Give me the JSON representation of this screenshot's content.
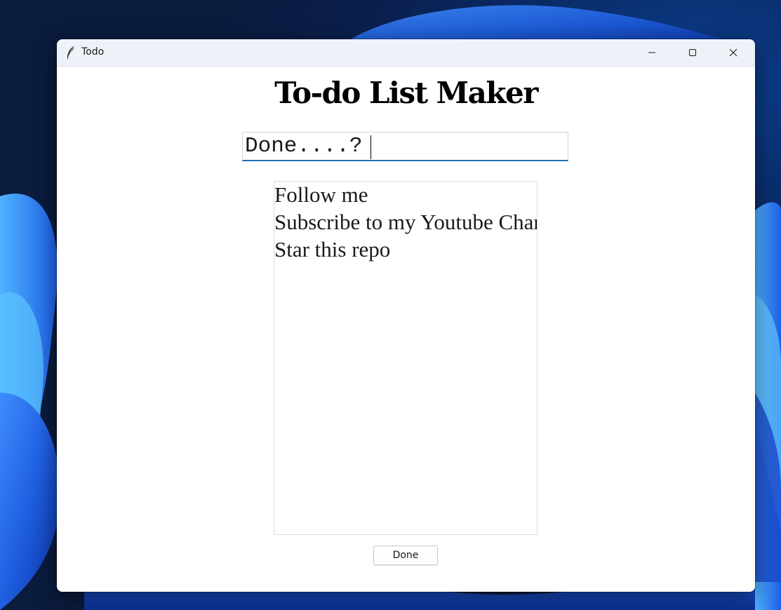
{
  "window": {
    "title": "Todo",
    "controls": {
      "minimize": "minimize-icon",
      "maximize": "maximize-icon",
      "close": "close-icon"
    }
  },
  "app": {
    "heading": "To-do List Maker",
    "entry_value": "Done....?",
    "entry_focus_color": "#1f6fb5",
    "tasks": [
      "Follow me",
      "Subscribe to my Youtube Channel",
      "Star this repo"
    ],
    "done_button": "Done"
  }
}
